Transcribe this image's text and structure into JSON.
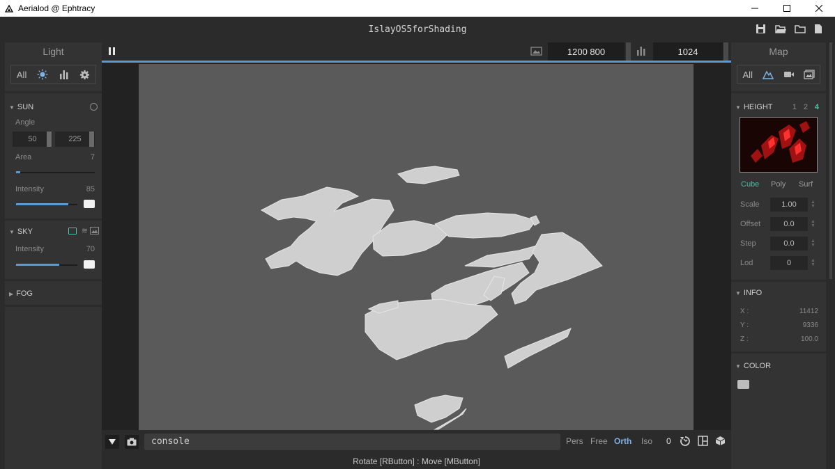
{
  "window": {
    "title": "Aerialod @ Ephtracy"
  },
  "header": {
    "doc_title": "IslayOS5forShading"
  },
  "left_panel": {
    "title": "Light",
    "tabs": [
      "All"
    ],
    "sun": {
      "label": "SUN",
      "angle_label": "Angle",
      "angle_1": "50",
      "angle_2": "225",
      "area_label": "Area",
      "area_value": "7",
      "area_fraction": 0.05,
      "intensity_label": "Intensity",
      "intensity_value": "85",
      "intensity_fraction": 0.85
    },
    "sky": {
      "label": "SKY",
      "intensity_label": "Intensity",
      "intensity_value": "70",
      "intensity_fraction": 0.7
    },
    "fog": {
      "label": "FOG"
    }
  },
  "toolbar": {
    "resolution": "1200  800",
    "samples": "1024"
  },
  "bottom": {
    "console_text": "console",
    "modes": [
      "Pers",
      "Free",
      "Orth",
      "Iso"
    ],
    "active_mode": "Orth",
    "counter": "0",
    "status": "Rotate [RButton] : Move [MButton]"
  },
  "right_panel": {
    "title": "Map",
    "tabs": [
      "All"
    ],
    "height": {
      "label": "HEIGHT",
      "lods": [
        "1",
        "2",
        "4"
      ],
      "active_lod": "4",
      "modes": [
        "Cube",
        "Poly",
        "Surf"
      ],
      "active_mode": "Cube",
      "fields": [
        {
          "label": "Scale",
          "value": "1.00"
        },
        {
          "label": "Offset",
          "value": "0.0"
        },
        {
          "label": "Step",
          "value": "0.0"
        },
        {
          "label": "Lod",
          "value": "0"
        }
      ]
    },
    "info": {
      "label": "INFO",
      "x_label": "X :",
      "x": "11412",
      "y_label": "Y :",
      "y": "9336",
      "z_label": "Z :",
      "z": "100.0"
    },
    "color": {
      "label": "COLOR"
    }
  },
  "colors": {
    "accent": "#5b9bd5",
    "active_green": "#4fc1a6",
    "panel": "#333333",
    "canvas": "#5a5a5a"
  }
}
